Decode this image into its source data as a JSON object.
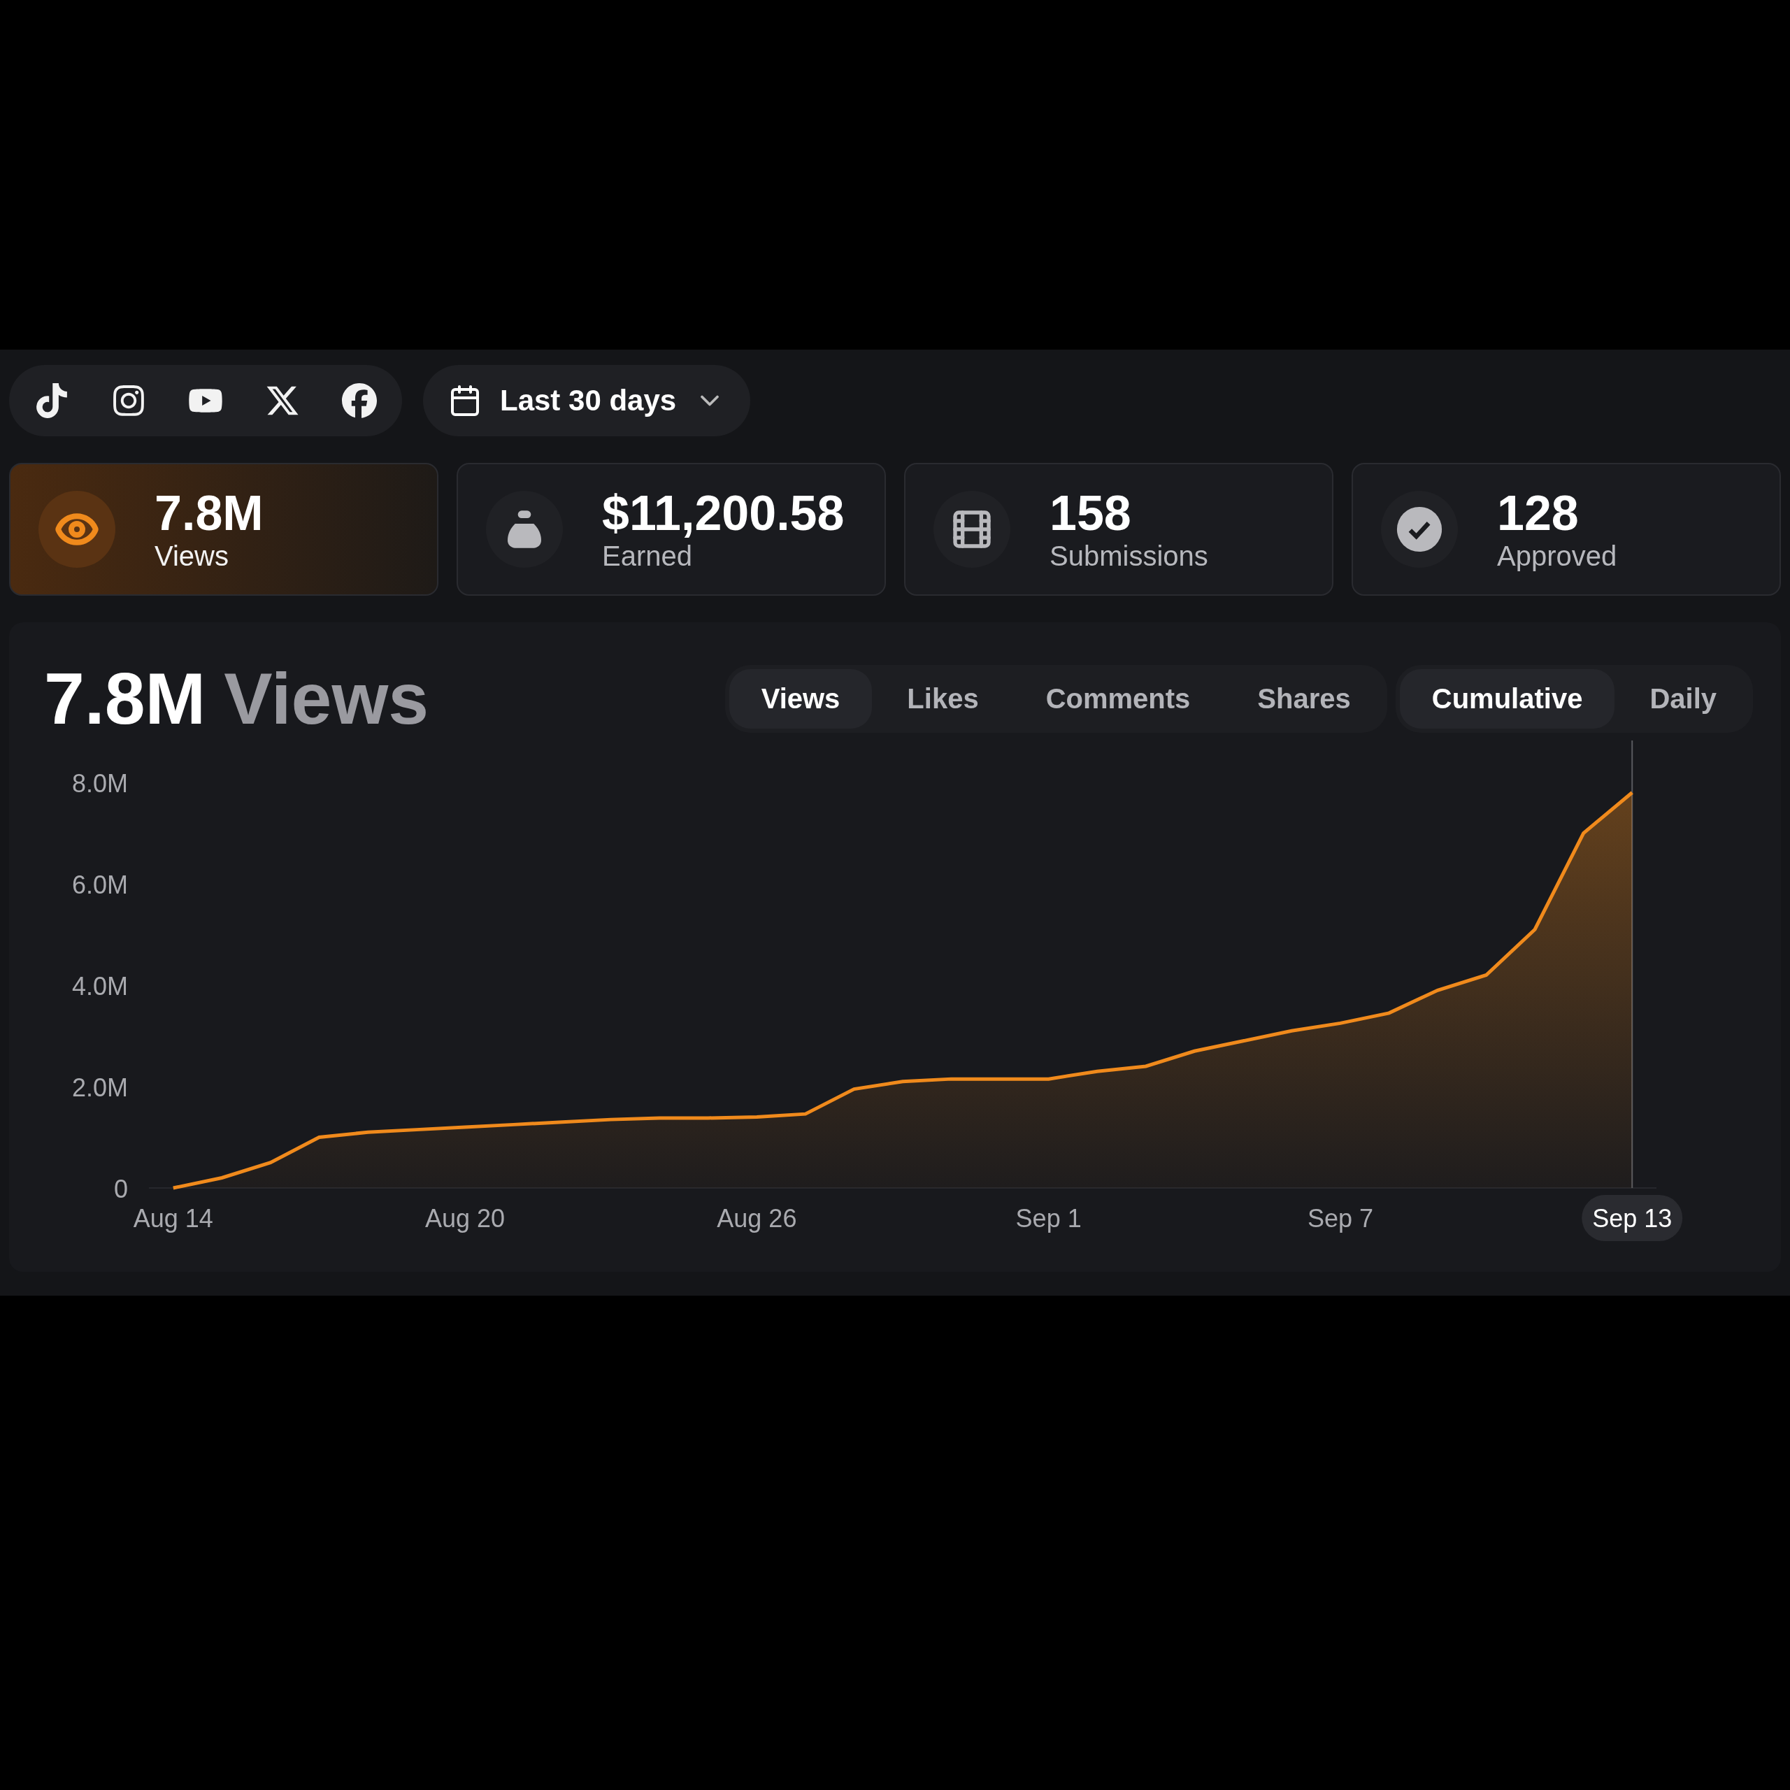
{
  "platforms": [
    {
      "kind": "tiktok"
    },
    {
      "kind": "instagram"
    },
    {
      "kind": "youtube"
    },
    {
      "kind": "x"
    },
    {
      "kind": "facebook"
    }
  ],
  "date_range": {
    "label": "Last 30 days"
  },
  "stats": [
    {
      "kind": "views",
      "value": "7.8M",
      "label": "Views",
      "selected": true
    },
    {
      "kind": "earned",
      "value": "$11,200.58",
      "label": "Earned",
      "selected": false
    },
    {
      "kind": "submissions",
      "value": "158",
      "label": "Submissions",
      "selected": false
    },
    {
      "kind": "approved",
      "value": "128",
      "label": "Approved",
      "selected": false
    }
  ],
  "chart_panel": {
    "headline_value": "7.8M",
    "headline_label": "Views",
    "metric_tabs": [
      {
        "label": "Views",
        "selected": true
      },
      {
        "label": "Likes",
        "selected": false
      },
      {
        "label": "Comments",
        "selected": false
      },
      {
        "label": "Shares",
        "selected": false
      }
    ],
    "mode_tabs": [
      {
        "label": "Cumulative",
        "selected": true
      },
      {
        "label": "Daily",
        "selected": false
      }
    ],
    "chart_data": {
      "type": "area",
      "categories": [
        "Aug 14",
        null,
        null,
        null,
        null,
        null,
        "Aug 20",
        null,
        null,
        null,
        null,
        null,
        "Aug 26",
        null,
        null,
        null,
        null,
        null,
        "Sep 1",
        null,
        null,
        null,
        null,
        null,
        "Sep 7",
        null,
        null,
        null,
        null,
        null,
        "Sep 13"
      ],
      "series": [
        {
          "color": "#f08a1c",
          "values": [
            0,
            0.2,
            0.5,
            1.0,
            1.1,
            1.15,
            1.2,
            1.25,
            1.3,
            1.35,
            1.38,
            1.38,
            1.4,
            1.46,
            1.95,
            2.1,
            2.15,
            2.15,
            2.15,
            2.3,
            2.4,
            2.7,
            2.9,
            3.1,
            3.25,
            3.45,
            3.9,
            4.2,
            5.1,
            7.0,
            7.8
          ]
        }
      ],
      "ylim": [
        0,
        8
      ],
      "yticks": [
        {
          "value": 0,
          "label": "0"
        },
        {
          "value": 2,
          "label": "2.0M"
        },
        {
          "value": 4,
          "label": "4.0M"
        },
        {
          "value": 6,
          "label": "6.0M"
        },
        {
          "value": 8,
          "label": "8.0M"
        }
      ],
      "annotations": [
        {
          "x": "Sep 13"
        }
      ]
    }
  }
}
